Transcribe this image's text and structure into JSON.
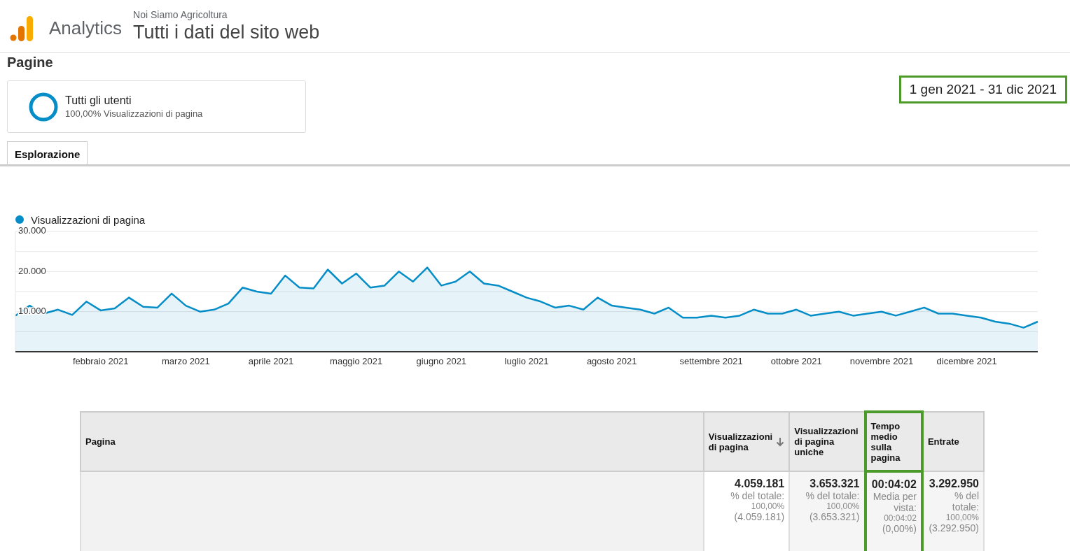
{
  "header": {
    "product": "Analytics",
    "account": "Noi Siamo Agricoltura",
    "view": "Tutti i dati del sito web"
  },
  "page_title": "Pagine",
  "segment": {
    "name": "Tutti gli utenti",
    "detail": "100,00% Visualizzazioni di pagina"
  },
  "date_range": {
    "label": "1 gen 2021 - 31 dic 2021",
    "highlighted": true
  },
  "tabs": [
    {
      "label": "Esplorazione",
      "selected": true
    }
  ],
  "chart": {
    "chart_data": {
      "type": "area",
      "series": [
        {
          "name": "Visualizzazioni di pagina",
          "color": "#058dc7",
          "values": [
            9000,
            11500,
            9500,
            10500,
            9200,
            12500,
            10300,
            10800,
            13500,
            11200,
            11000,
            14500,
            11500,
            10000,
            10500,
            12000,
            16000,
            15000,
            14500,
            19000,
            16000,
            15800,
            20500,
            17000,
            19500,
            16000,
            16500,
            20000,
            17500,
            21000,
            16500,
            17500,
            20000,
            17000,
            16500,
            15000,
            13500,
            12500,
            11000,
            11500,
            10500,
            13500,
            11500,
            11000,
            10500,
            9500,
            11000,
            8500,
            8500,
            9000,
            8500,
            9000,
            10500,
            9500,
            9500,
            10500,
            9000,
            9500,
            10000,
            9000,
            9500,
            10000,
            9000,
            10000,
            11000,
            9500,
            9500,
            9000,
            8500,
            7500,
            7000,
            6000,
            7500
          ]
        }
      ],
      "categories": [
        null,
        null,
        null,
        null,
        null,
        null,
        "febbraio 2021",
        null,
        null,
        null,
        null,
        null,
        "marzo 2021",
        null,
        null,
        null,
        null,
        null,
        "aprile 2021",
        null,
        null,
        null,
        null,
        null,
        "maggio 2021",
        null,
        null,
        null,
        null,
        null,
        "giugno 2021",
        null,
        null,
        null,
        null,
        null,
        "luglio 2021",
        null,
        null,
        null,
        null,
        null,
        "agosto 2021",
        null,
        null,
        null,
        null,
        null,
        null,
        "settembre 2021",
        null,
        null,
        null,
        null,
        null,
        "ottobre 2021",
        null,
        null,
        null,
        null,
        null,
        "novembre 2021",
        null,
        null,
        null,
        null,
        null,
        "dicembre 2021",
        null,
        null,
        null,
        null,
        null
      ],
      "ylim": [
        0,
        30000
      ],
      "yticks": [
        {
          "value": 10000,
          "label": "10.000"
        },
        {
          "value": 20000,
          "label": "20.000"
        },
        {
          "value": 30000,
          "label": "30.000"
        }
      ]
    }
  },
  "table": {
    "columns": [
      {
        "label": "Pagina",
        "sorted": false,
        "highlighted": false
      },
      {
        "label": "Visualizzazioni di pagina",
        "sorted": true,
        "highlighted": false
      },
      {
        "label": "Visualizzazioni di pagina uniche",
        "sorted": false,
        "highlighted": false
      },
      {
        "label": "Tempo medio sulla pagina",
        "sorted": false,
        "highlighted": true
      },
      {
        "label": "Entrate",
        "sorted": false,
        "highlighted": false
      }
    ],
    "totals": [
      {
        "value": "4.059.181",
        "detail": "% del totale:",
        "share": "100,00%",
        "base": "(4.059.181)"
      },
      {
        "value": "3.653.321",
        "detail": "% del totale:",
        "share": "100,00%",
        "base": "(3.653.321)"
      },
      {
        "value": "00:04:02",
        "detail": "Media per vista:",
        "share": "00:04:02",
        "base": "(0,00%)"
      },
      {
        "value": "3.292.950",
        "detail": "% del totale:",
        "share": "100,00%",
        "base": "(3.292.950)"
      }
    ]
  }
}
